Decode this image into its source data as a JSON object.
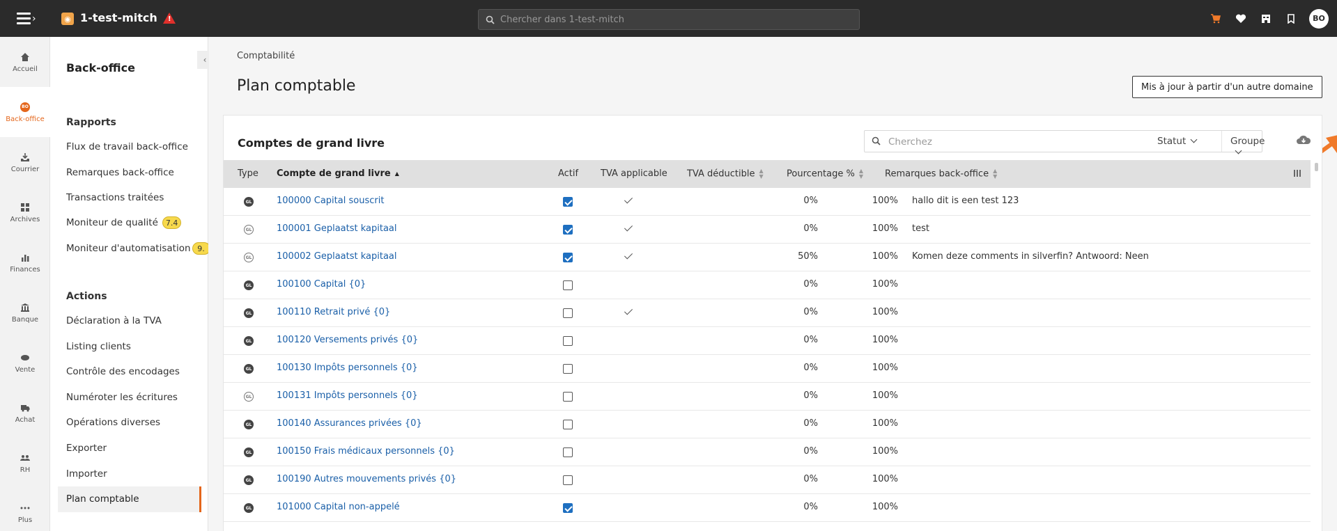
{
  "topbar": {
    "app_title": "1-test-mitch",
    "search_placeholder": "Chercher dans 1-test-mitch",
    "avatar_initials": "BO",
    "icons": [
      "cart-icon",
      "heart-icon",
      "building-icon",
      "bookmark-icon"
    ]
  },
  "leftnav": {
    "items": [
      {
        "label": "Accueil",
        "icon": "home-icon"
      },
      {
        "label": "Back-office",
        "icon": "bo-icon",
        "active": true,
        "icon_text": "BO"
      },
      {
        "label": "Courrier",
        "icon": "inbox-icon"
      },
      {
        "label": "Archives",
        "icon": "archives-icon"
      },
      {
        "label": "Finances",
        "icon": "chart-icon"
      },
      {
        "label": "Banque",
        "icon": "bank-icon"
      },
      {
        "label": "Vente",
        "icon": "handshake-icon"
      },
      {
        "label": "Achat",
        "icon": "truck-icon"
      },
      {
        "label": "RH",
        "icon": "people-icon"
      },
      {
        "label": "Plus",
        "icon": "more-icon"
      }
    ]
  },
  "subnav": {
    "header": "Back-office",
    "reports_title": "Rapports",
    "reports": [
      {
        "label": "Flux de travail back-office"
      },
      {
        "label": "Remarques back-office"
      },
      {
        "label": "Transactions traitées"
      },
      {
        "label": "Moniteur de qualité",
        "badge": "7.4"
      },
      {
        "label": "Moniteur d'automatisation",
        "badge": "9."
      }
    ],
    "actions_title": "Actions",
    "actions": [
      {
        "label": "Déclaration à la TVA"
      },
      {
        "label": "Listing clients"
      },
      {
        "label": "Contrôle des encodages"
      },
      {
        "label": "Numéroter les écritures"
      },
      {
        "label": "Opérations diverses"
      },
      {
        "label": "Exporter"
      },
      {
        "label": "Importer"
      }
    ],
    "active_item": "Plan comptable"
  },
  "main": {
    "breadcrumb": "Comptabilité",
    "title": "Plan comptable",
    "update_button": "Mis à jour à partir d'un autre domaine",
    "accent_color": "#f07a2a"
  },
  "card": {
    "title": "Comptes de grand livre",
    "search_placeholder": "Cherchez",
    "status_filter": "Statut",
    "group_filter": "Groupe"
  },
  "table": {
    "columns": {
      "type": "Type",
      "account": "Compte de grand livre",
      "active": "Actif",
      "vat_applicable": "TVA applicable",
      "vat_deductible": "TVA déductible",
      "percentage": "Pourcentage %",
      "remarks": "Remarques back-office"
    },
    "rows": [
      {
        "type": "GL",
        "type_style": "filled",
        "account": "100000 Capital souscrit",
        "active": true,
        "vat": true,
        "deductible": "0%",
        "pct": "100%",
        "remarks": "hallo dit is een test 123"
      },
      {
        "type": "GL",
        "type_style": "outline",
        "account": "100001 Geplaatst kapitaal",
        "active": true,
        "vat": true,
        "deductible": "0%",
        "pct": "100%",
        "remarks": "test"
      },
      {
        "type": "GL",
        "type_style": "outline",
        "account": "100002 Geplaatst kapitaal",
        "active": true,
        "vat": true,
        "deductible": "50%",
        "pct": "100%",
        "remarks": "Komen deze comments in silverfin? Antwoord: Neen"
      },
      {
        "type": "GL",
        "type_style": "filled",
        "account": "100100 Capital {0}",
        "active": false,
        "vat": false,
        "deductible": "0%",
        "pct": "100%",
        "remarks": ""
      },
      {
        "type": "GL",
        "type_style": "filled",
        "account": "100110 Retrait privé {0}",
        "active": false,
        "vat": true,
        "deductible": "0%",
        "pct": "100%",
        "remarks": ""
      },
      {
        "type": "GL",
        "type_style": "filled",
        "account": "100120 Versements privés {0}",
        "active": false,
        "vat": false,
        "deductible": "0%",
        "pct": "100%",
        "remarks": ""
      },
      {
        "type": "GL",
        "type_style": "filled",
        "account": "100130 Impôts personnels {0}",
        "active": false,
        "vat": false,
        "deductible": "0%",
        "pct": "100%",
        "remarks": ""
      },
      {
        "type": "GL",
        "type_style": "outline",
        "account": "100131 Impôts personnels {0}",
        "active": false,
        "vat": false,
        "deductible": "0%",
        "pct": "100%",
        "remarks": ""
      },
      {
        "type": "GL",
        "type_style": "filled",
        "account": "100140 Assurances privées {0}",
        "active": false,
        "vat": false,
        "deductible": "0%",
        "pct": "100%",
        "remarks": ""
      },
      {
        "type": "GL",
        "type_style": "filled",
        "account": "100150 Frais médicaux personnels {0}",
        "active": false,
        "vat": false,
        "deductible": "0%",
        "pct": "100%",
        "remarks": ""
      },
      {
        "type": "GL",
        "type_style": "filled",
        "account": "100190 Autres mouvements privés {0}",
        "active": false,
        "vat": false,
        "deductible": "0%",
        "pct": "100%",
        "remarks": ""
      },
      {
        "type": "GL",
        "type_style": "filled",
        "account": "101000 Capital non-appelé",
        "active": true,
        "vat": false,
        "deductible": "0%",
        "pct": "100%",
        "remarks": ""
      }
    ]
  }
}
